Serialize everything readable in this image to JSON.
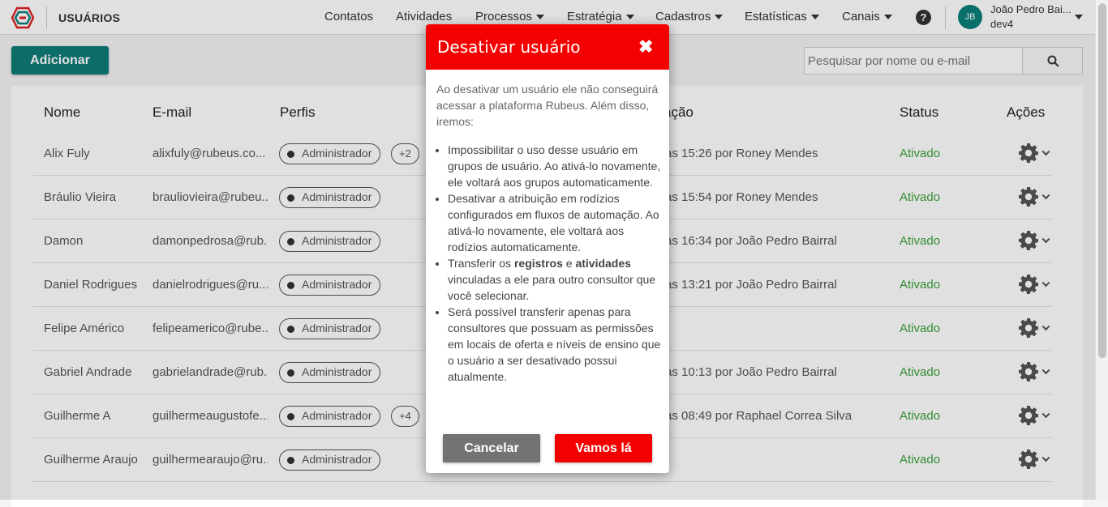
{
  "header": {
    "title": "USUÁRIOS",
    "nav": [
      {
        "label": "Contatos",
        "dropdown": false
      },
      {
        "label": "Atividades",
        "dropdown": false
      },
      {
        "label": "Processos",
        "dropdown": true
      },
      {
        "label": "Estratégia",
        "dropdown": true
      },
      {
        "label": "Cadastros",
        "dropdown": true
      },
      {
        "label": "Estatísticas",
        "dropdown": true
      },
      {
        "label": "Canais",
        "dropdown": true
      }
    ],
    "help_icon": "?",
    "user": {
      "initials": "JB",
      "name": "João Pedro Bai...",
      "org": "dev4"
    }
  },
  "toolbar": {
    "add_label": "Adicionar",
    "search_placeholder": "Pesquisar por nome ou e-mail"
  },
  "table": {
    "columns": {
      "name": "Nome",
      "email": "E-mail",
      "profiles": "Perfis",
      "updated": "ação",
      "status": "Status",
      "actions": "Ações"
    },
    "rows": [
      {
        "name": "Alix Fuly",
        "email": "alixfuly@rubeus.co...",
        "profile": "Administrador",
        "extra": "+2",
        "updated": "as 15:26 por Roney Mendes",
        "status": "Ativado"
      },
      {
        "name": "Bráulio Vieira",
        "email": "brauliovieira@rubeu...",
        "profile": "Administrador",
        "extra": "",
        "updated": "as 15:54 por Roney Mendes",
        "status": "Ativado"
      },
      {
        "name": "Damon",
        "email": "damonpedrosa@rub...",
        "profile": "Administrador",
        "extra": "",
        "updated": "as 16:34 por João Pedro Bairral",
        "status": "Ativado"
      },
      {
        "name": "Daniel Rodrigues",
        "email": "danielrodrigues@ru...",
        "profile": "Administrador",
        "extra": "",
        "updated": "as 13:21 por João Pedro Bairral",
        "status": "Ativado"
      },
      {
        "name": "Felipe Américo",
        "email": "felipeamerico@rube...",
        "profile": "Administrador",
        "extra": "",
        "updated": "",
        "status": "Ativado"
      },
      {
        "name": "Gabriel Andrade",
        "email": "gabrielandrade@rub...",
        "profile": "Administrador",
        "extra": "",
        "updated": "as 10:13 por João Pedro Bairral",
        "status": "Ativado"
      },
      {
        "name": "Guilherme A",
        "email": "guilhermeaugustofe...",
        "profile": "Administrador",
        "extra": "+4",
        "updated": "as 08:49 por Raphael Correa Silva",
        "status": "Ativado"
      },
      {
        "name": "Guilherme Araujo",
        "email": "guilhermearaujo@ru...",
        "profile": "Administrador",
        "extra": "",
        "updated": "",
        "status": "Ativado"
      }
    ]
  },
  "modal": {
    "title": "Desativar usuário",
    "close_icon": "✖",
    "intro": "Ao desativar um usuário ele não conseguirá acessar a plataforma Rubeus. Além disso, iremos:",
    "bullet1": "Impossibilitar o uso desse usuário em grupos de usuário. Ao ativá-lo novamente, ele voltará aos grupos automaticamente.",
    "bullet2": "Desativar a atribuição em rodízios configurados em fluxos de automação. Ao ativá-lo novamente, ele voltará aos rodízios automaticamente.",
    "bullet3_pre": "Transferir os ",
    "bullet3_b1": "registros",
    "bullet3_mid": " e ",
    "bullet3_b2": "atividades",
    "bullet3_post": " vinculadas a ele para outro consultor que você selecionar.",
    "bullet4": "Será possível transferir apenas para consultores que possuam as permissões em locais de oferta e níveis de ensino que o usuário a ser desativado possui atualmente.",
    "cancel_label": "Cancelar",
    "confirm_label": "Vamos lá"
  }
}
